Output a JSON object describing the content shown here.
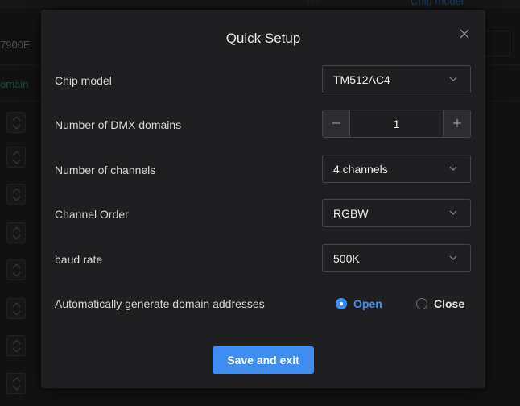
{
  "background": {
    "left_text_top": "7900E",
    "left_text_domain": "omain",
    "header_text_center": "ID",
    "header_text_right": "Chip model"
  },
  "modal": {
    "title": "Quick Setup",
    "close_glyph": "✕",
    "fields": {
      "chip_model": {
        "label": "Chip model",
        "value": "TM512AC4"
      },
      "dmx_domains": {
        "label": "Number of DMX domains",
        "value": "1",
        "minus": "−",
        "plus": "+"
      },
      "channels": {
        "label": "Number of channels",
        "value": "4 channels"
      },
      "channel_order": {
        "label": "Channel Order",
        "value": "RGBW"
      },
      "baud_rate": {
        "label": "baud rate",
        "value": "500K"
      },
      "auto_generate": {
        "label": "Automatically generate domain addresses",
        "options": [
          {
            "label": "Open",
            "selected": true
          },
          {
            "label": "Close",
            "selected": false
          }
        ]
      }
    },
    "save_label": "Save and exit"
  },
  "icons": {
    "close": "close-icon",
    "chevron": "chevron-down-icon",
    "minus": "minus-icon",
    "plus": "plus-icon"
  },
  "colors": {
    "accent": "#3d8ef0",
    "modal_bg": "#1f1f21",
    "border": "#434347",
    "text": "#d6d6d6"
  }
}
